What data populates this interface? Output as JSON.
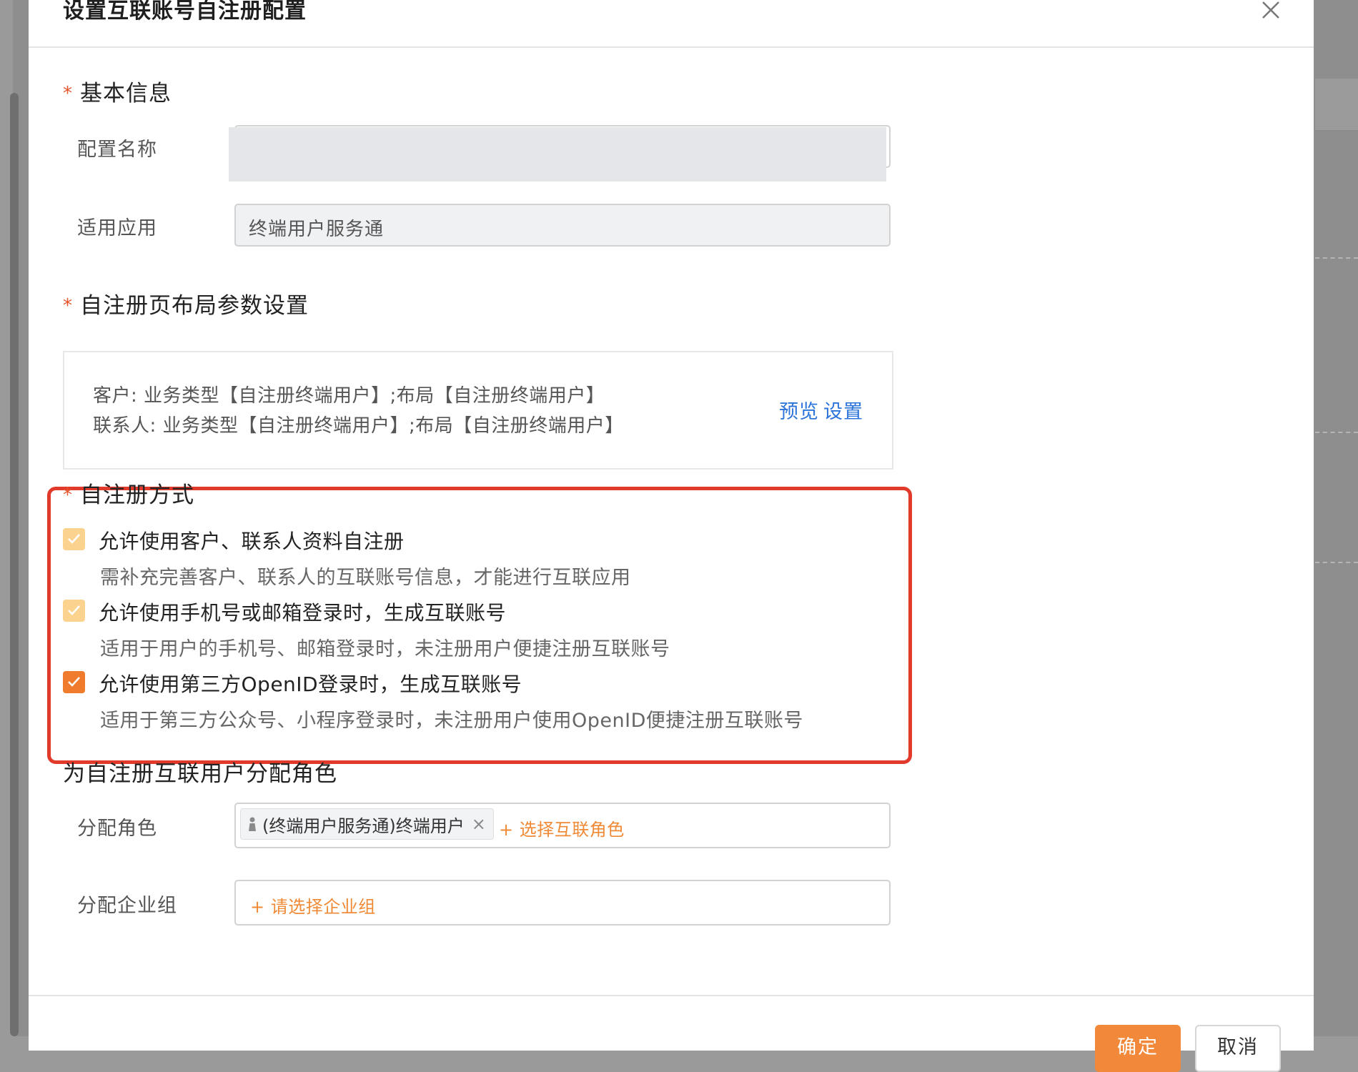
{
  "dialog": {
    "title": "设置互联账号自注册配置",
    "close_icon": "close-icon"
  },
  "basic_info": {
    "title": "基本信息",
    "required_mark": "*",
    "config_name": {
      "label": "配置名称",
      "value": ""
    },
    "app": {
      "label": "适用应用",
      "value": "终端用户服务通"
    }
  },
  "layout_settings": {
    "title": "自注册页布局参数设置",
    "required_mark": "*",
    "line1": "客户: 业务类型【自注册终端用户】;布局【自注册终端用户】",
    "line2": "联系人: 业务类型【自注册终端用户】;布局【自注册终端用户】",
    "preview_link": "预览",
    "settings_link": "设置"
  },
  "registration_method": {
    "title": "自注册方式",
    "required_mark": "*",
    "options": [
      {
        "label": "允许使用客户、联系人资料自注册",
        "desc": "需补充完善客户、联系人的互联账号信息，才能进行互联应用",
        "checked": true,
        "state": "checked-disabled"
      },
      {
        "label": "允许使用手机号或邮箱登录时，生成互联账号",
        "desc": "适用于用户的手机号、邮箱登录时，未注册用户便捷注册互联账号",
        "checked": true,
        "state": "checked-disabled"
      },
      {
        "label": "允许使用第三方OpenID登录时，生成互联账号",
        "desc": "适用于第三方公众号、小程序登录时，未注册用户使用OpenID便捷注册互联账号",
        "checked": true,
        "state": "checked"
      }
    ]
  },
  "role_assignment": {
    "title": "为自注册互联用户分配角色",
    "role": {
      "label": "分配角色",
      "tag_text": "(终端用户服务通)终端用户",
      "tag_remove": "×",
      "add_text": "+ 选择互联角色"
    },
    "group": {
      "label": "分配企业组",
      "add_text": "+ 请选择企业组"
    }
  },
  "footer": {
    "ok_label": "确定",
    "cancel_label": "取消"
  },
  "colors": {
    "accent": "#f1883a",
    "link": "#2c74d9",
    "required": "#e8542b",
    "highlight_frame": "#e23a2a",
    "checkbox_disabled": "#fbd38f",
    "checkbox_checked": "#f07b2c"
  }
}
